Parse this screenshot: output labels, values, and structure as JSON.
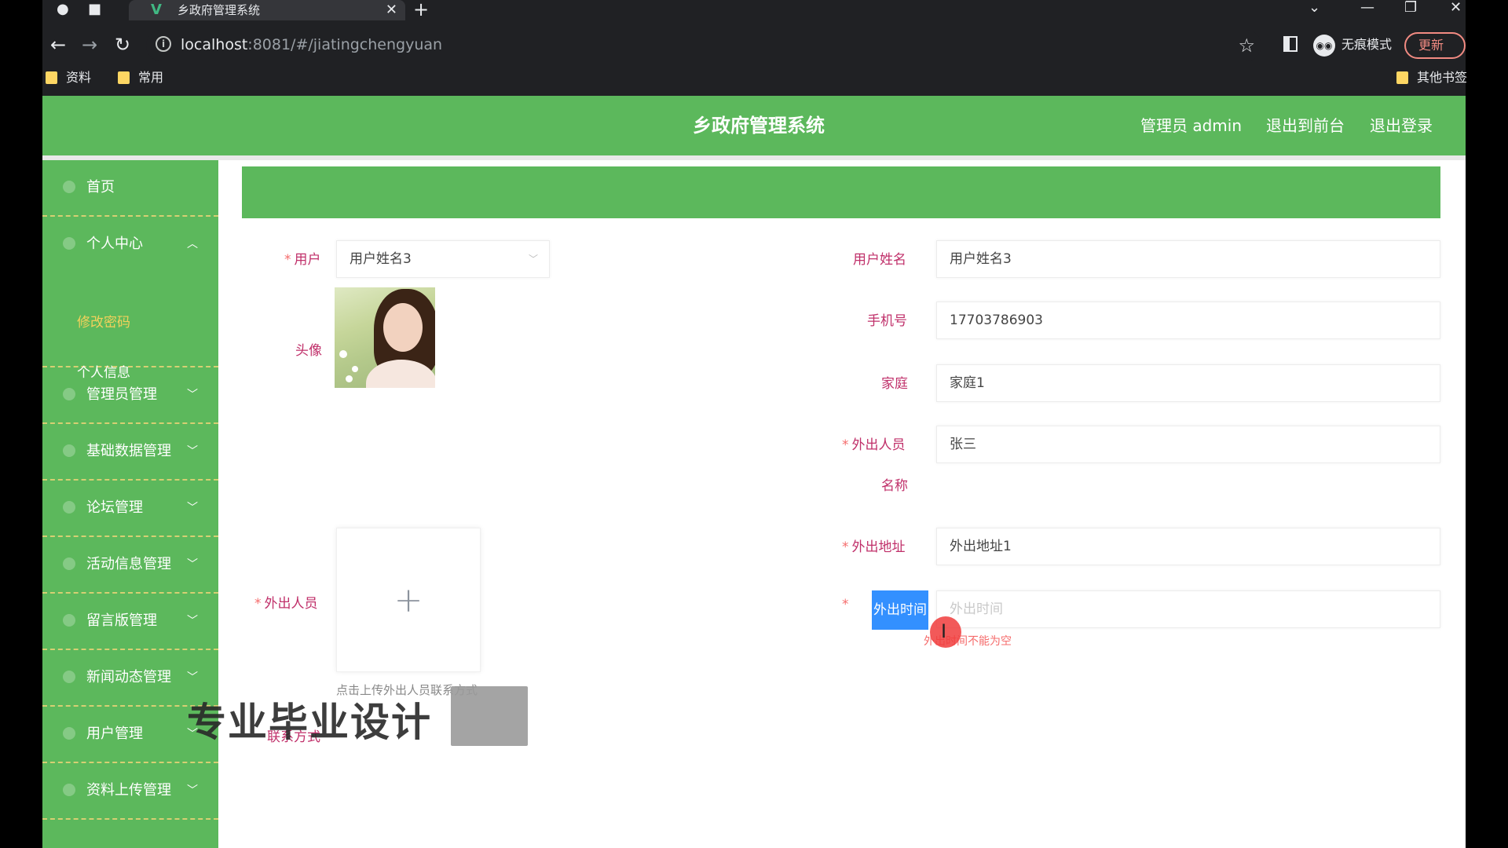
{
  "browser": {
    "tab_title": "乡政府管理系统",
    "tab_favicon": "V",
    "url_host": "localhost",
    "url_rest": ":8081/#/jiatingchengyuan",
    "incognito_label": "无痕模式",
    "update_label": "更新",
    "bookmarks": [
      "资料",
      "常用"
    ],
    "other_bookmarks": "其他书签"
  },
  "header": {
    "title": "乡政府管理系统",
    "admin_label": "管理员 admin",
    "back_to_front": "退出到前台",
    "logout": "退出登录"
  },
  "sidebar": {
    "items": [
      {
        "label": "首页"
      },
      {
        "label": "个人中心",
        "expanded": true,
        "children": [
          "修改密码",
          "个人信息"
        ]
      },
      {
        "label": "管理员管理"
      },
      {
        "label": "基础数据管理"
      },
      {
        "label": "论坛管理"
      },
      {
        "label": "活动信息管理"
      },
      {
        "label": "留言版管理"
      },
      {
        "label": "新闻动态管理"
      },
      {
        "label": "用户管理"
      },
      {
        "label": "资料上传管理"
      }
    ],
    "active_child_color": "#f2d15b"
  },
  "form": {
    "user_label": "用户",
    "user_value": "用户姓名3",
    "avatar_label": "头像",
    "outgoer_label": "外出人员",
    "contact_label": "联系方式",
    "upload_hint": "点击上传外出人员联系方式",
    "username_label": "用户姓名",
    "username_value": "用户姓名3",
    "phone_label": "手机号",
    "phone_value": "17703786903",
    "family_label": "家庭",
    "family_value": "家庭1",
    "outgoer_name_label_1": "外出人员",
    "outgoer_name_label_2": "名称",
    "outgoer_name_value": "张三",
    "address_label": "外出地址",
    "address_value": "外出地址1",
    "time_label": "外出时间",
    "time_placeholder": "外出时间",
    "time_error": "外出时间不能为空"
  },
  "overlay": {
    "watermark": "专业毕业设计"
  },
  "colors": {
    "brand_green": "#5cb85c",
    "label_pink": "#c0306a",
    "error_red": "#f56c6c",
    "focus_blue": "#3390ff"
  }
}
